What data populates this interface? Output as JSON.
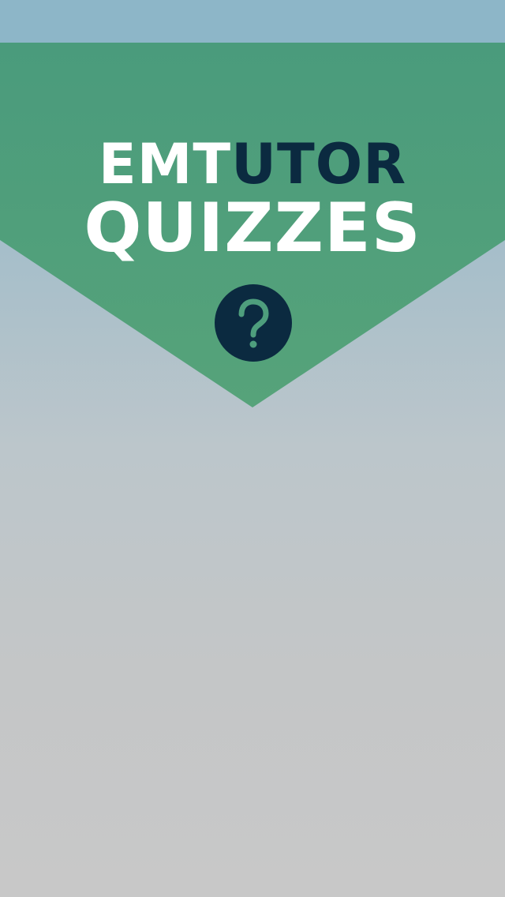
{
  "title": {
    "part1": "EMT",
    "part2": "UTOR",
    "line2": "QUIZZES"
  },
  "icons": {
    "help": "question-mark-icon"
  },
  "colors": {
    "banner": "#4e9e7d",
    "accent": "#0b2a40",
    "status_bar": "#8db6c8",
    "text": "#ffffff"
  }
}
